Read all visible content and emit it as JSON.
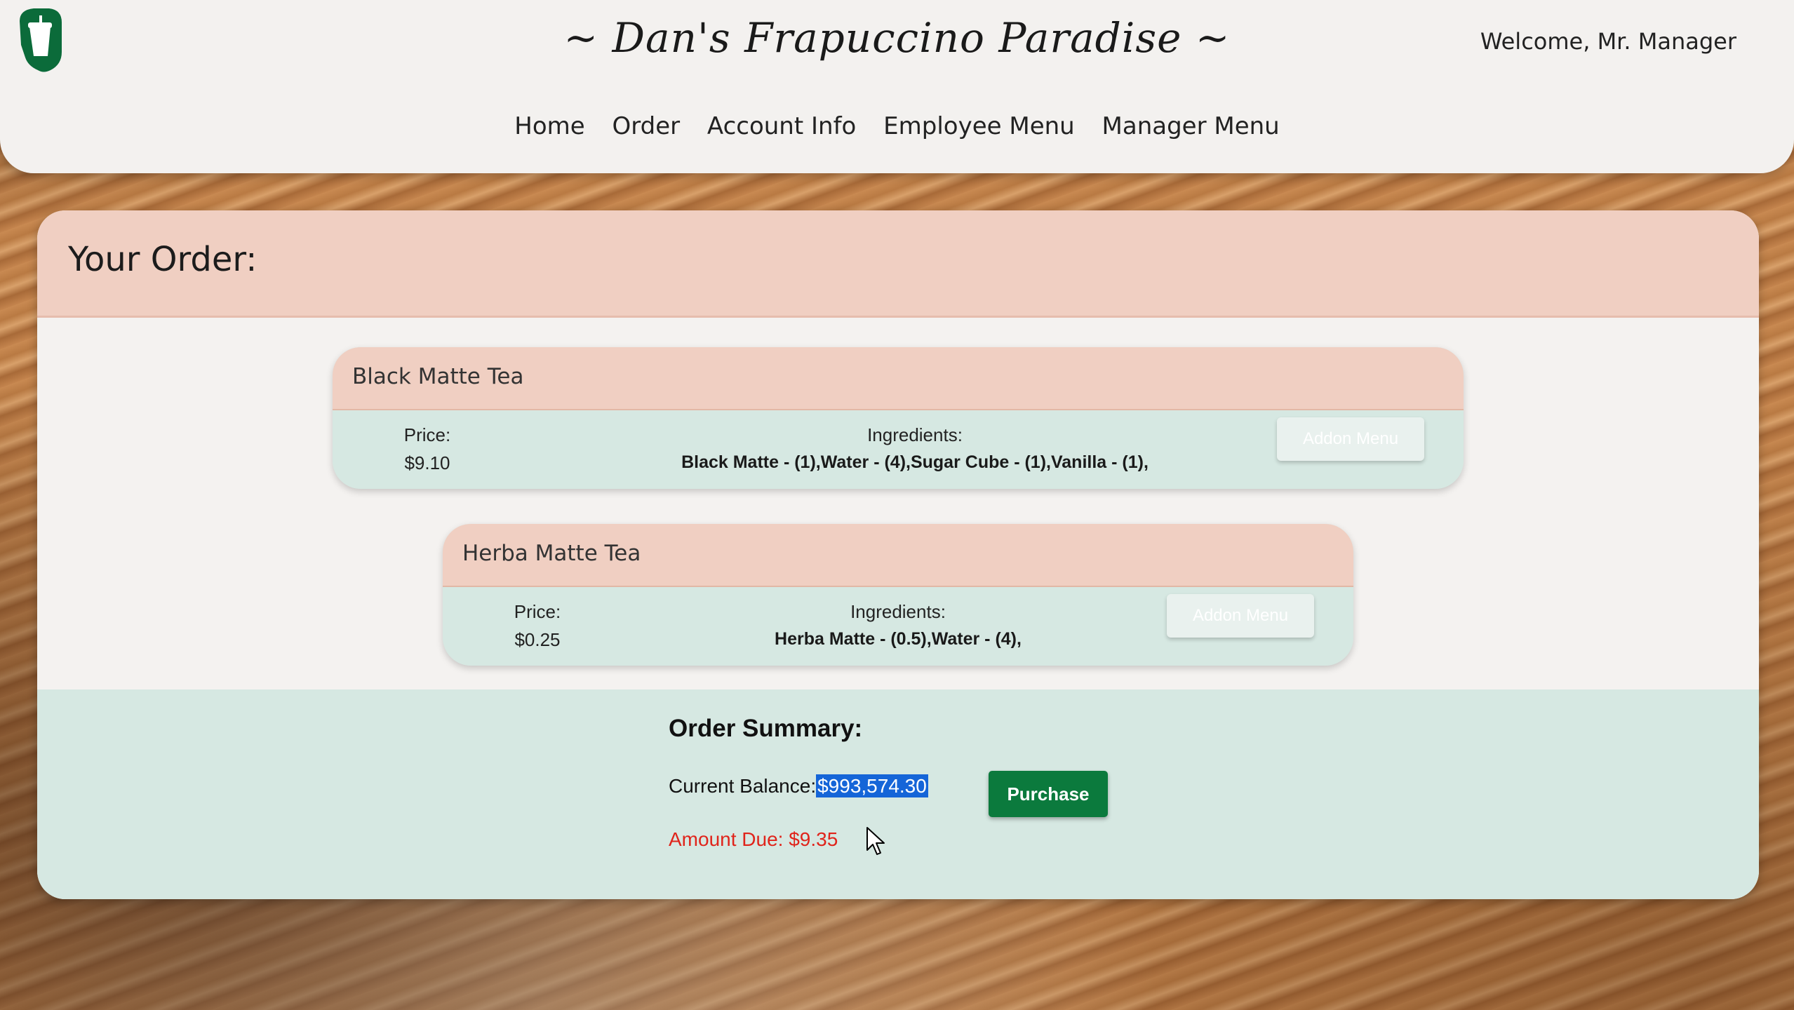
{
  "header": {
    "site_title": "~ Dan's Frapuccino Paradise ~",
    "welcome": "Welcome, Mr. Manager",
    "nav": [
      "Home",
      "Order",
      "Account Info",
      "Employee Menu",
      "Manager Menu"
    ],
    "logo_icon": "cup-logo-icon",
    "brand_color": "#0b7a3d"
  },
  "order": {
    "title": "Your Order:",
    "price_label": "Price:",
    "ingredients_label": "Ingredients:",
    "addon_label": "Addon Menu",
    "items": [
      {
        "name": "Black Matte Tea",
        "price": "$9.10",
        "ingredients": "Black Matte - (1),Water - (4),Sugar Cube - (1),Vanilla - (1),"
      },
      {
        "name": "Herba Matte Tea",
        "price": "$0.25",
        "ingredients": "Herba Matte - (0.5),Water - (4),"
      }
    ]
  },
  "summary": {
    "title": "Order Summary:",
    "balance_label": "Current Balance:",
    "balance_value": "$993,574.30",
    "amount_due": "Amount Due: $9.35",
    "purchase_label": "Purchase"
  }
}
